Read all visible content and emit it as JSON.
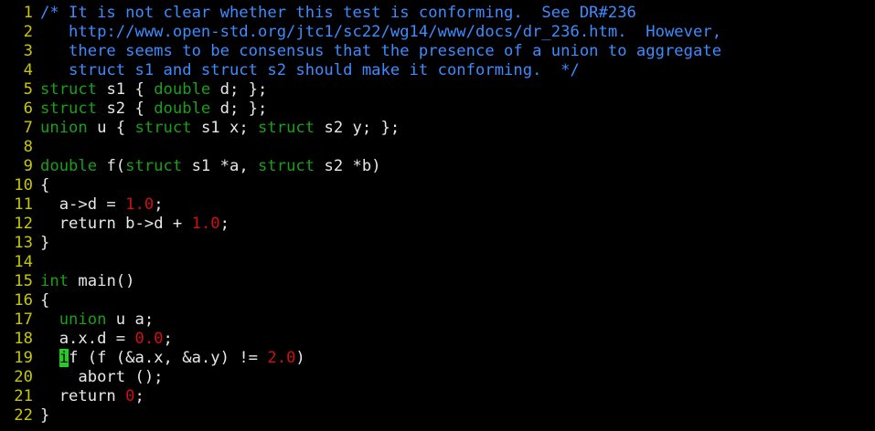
{
  "editor": {
    "cursor": {
      "line": 19,
      "column": 3
    },
    "lines": [
      {
        "n": "1",
        "tokens": [
          {
            "t": "/* It is not clear whether this test is conforming.  See DR#236",
            "c": "comment"
          }
        ]
      },
      {
        "n": "2",
        "tokens": [
          {
            "t": "   http://www.open-std.org/jtc1/sc22/wg14/www/docs/dr_236.htm.  However,",
            "c": "comment"
          }
        ]
      },
      {
        "n": "3",
        "tokens": [
          {
            "t": "   there seems to be consensus that the presence of a union to aggregate",
            "c": "comment"
          }
        ]
      },
      {
        "n": "4",
        "tokens": [
          {
            "t": "   struct s1 and struct s2 should make it conforming.  */",
            "c": "comment"
          }
        ]
      },
      {
        "n": "5",
        "tokens": [
          {
            "t": "struct",
            "c": "type"
          },
          {
            "t": " s1 { ",
            "c": "plain"
          },
          {
            "t": "double",
            "c": "type"
          },
          {
            "t": " d; };",
            "c": "plain"
          }
        ]
      },
      {
        "n": "6",
        "tokens": [
          {
            "t": "struct",
            "c": "type"
          },
          {
            "t": " s2 { ",
            "c": "plain"
          },
          {
            "t": "double",
            "c": "type"
          },
          {
            "t": " d; };",
            "c": "plain"
          }
        ]
      },
      {
        "n": "7",
        "tokens": [
          {
            "t": "union",
            "c": "type"
          },
          {
            "t": " u { ",
            "c": "plain"
          },
          {
            "t": "struct",
            "c": "type"
          },
          {
            "t": " s1 x; ",
            "c": "plain"
          },
          {
            "t": "struct",
            "c": "type"
          },
          {
            "t": " s2 y; };",
            "c": "plain"
          }
        ]
      },
      {
        "n": "8",
        "tokens": []
      },
      {
        "n": "9",
        "tokens": [
          {
            "t": "double",
            "c": "type"
          },
          {
            "t": " f(",
            "c": "plain"
          },
          {
            "t": "struct",
            "c": "type"
          },
          {
            "t": " s1 *a, ",
            "c": "plain"
          },
          {
            "t": "struct",
            "c": "type"
          },
          {
            "t": " s2 *b)",
            "c": "plain"
          }
        ]
      },
      {
        "n": "10",
        "tokens": [
          {
            "t": "{",
            "c": "plain"
          }
        ]
      },
      {
        "n": "11",
        "tokens": [
          {
            "t": "  a->d = ",
            "c": "plain"
          },
          {
            "t": "1.0",
            "c": "num"
          },
          {
            "t": ";",
            "c": "plain"
          }
        ]
      },
      {
        "n": "12",
        "tokens": [
          {
            "t": "  ",
            "c": "plain"
          },
          {
            "t": "return",
            "c": "plain"
          },
          {
            "t": " b->d + ",
            "c": "plain"
          },
          {
            "t": "1.0",
            "c": "num"
          },
          {
            "t": ";",
            "c": "plain"
          }
        ]
      },
      {
        "n": "13",
        "tokens": [
          {
            "t": "}",
            "c": "plain"
          }
        ]
      },
      {
        "n": "14",
        "tokens": []
      },
      {
        "n": "15",
        "tokens": [
          {
            "t": "int",
            "c": "type"
          },
          {
            "t": " main()",
            "c": "plain"
          }
        ]
      },
      {
        "n": "16",
        "tokens": [
          {
            "t": "{",
            "c": "plain"
          }
        ]
      },
      {
        "n": "17",
        "tokens": [
          {
            "t": "  ",
            "c": "plain"
          },
          {
            "t": "union",
            "c": "type"
          },
          {
            "t": " u a;",
            "c": "plain"
          }
        ]
      },
      {
        "n": "18",
        "tokens": [
          {
            "t": "  a.x.d = ",
            "c": "plain"
          },
          {
            "t": "0.0",
            "c": "num"
          },
          {
            "t": ";",
            "c": "plain"
          }
        ]
      },
      {
        "n": "19",
        "tokens": [
          {
            "t": "  ",
            "c": "plain"
          },
          {
            "t": "i",
            "c": "cursor"
          },
          {
            "t": "f (f (&a.x, &a.y) != ",
            "c": "plain"
          },
          {
            "t": "2.0",
            "c": "num"
          },
          {
            "t": ")",
            "c": "plain"
          }
        ]
      },
      {
        "n": "20",
        "tokens": [
          {
            "t": "    abort ();",
            "c": "plain"
          }
        ]
      },
      {
        "n": "21",
        "tokens": [
          {
            "t": "  return ",
            "c": "plain"
          },
          {
            "t": "0",
            "c": "num"
          },
          {
            "t": ";",
            "c": "plain"
          }
        ]
      },
      {
        "n": "22",
        "tokens": [
          {
            "t": "}",
            "c": "plain"
          }
        ]
      }
    ]
  },
  "colors": {
    "background": "#000000",
    "line_number": "#c8c800",
    "comment": "#3c8cff",
    "type_keyword": "#18a018",
    "number": "#d01010",
    "plain": "#e8e8e8",
    "cursor": "#20d020"
  }
}
